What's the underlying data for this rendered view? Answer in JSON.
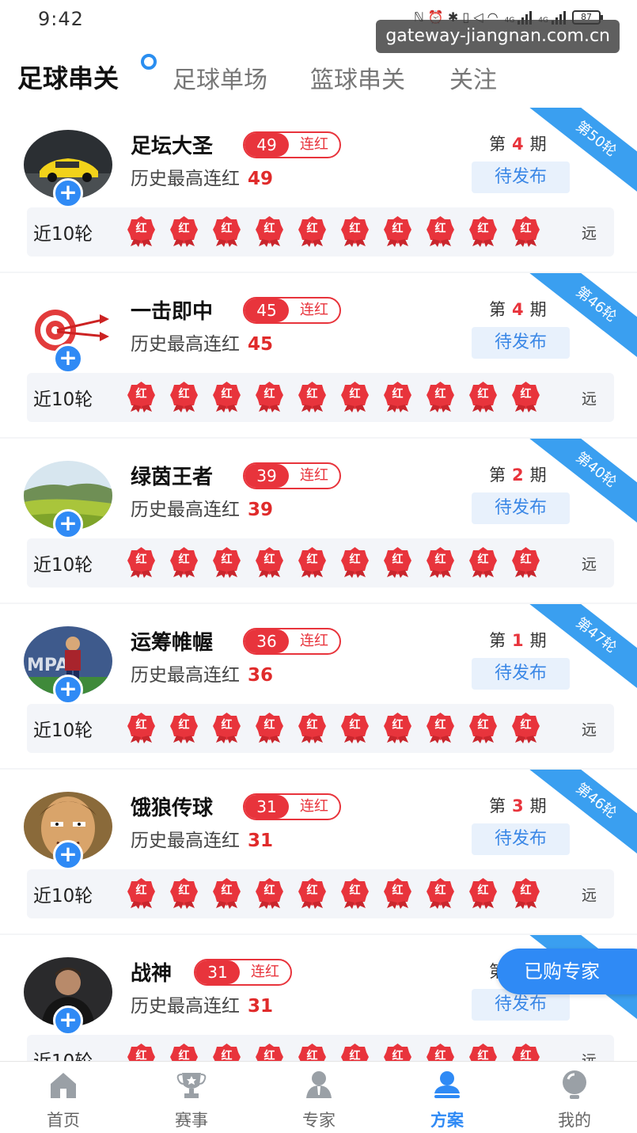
{
  "status_bar": {
    "time": "9:42",
    "icons": "ℕ ⏰ ✱ ▯ ◁ ◠",
    "sig1": "4G",
    "sig2": "4G",
    "battery": "87"
  },
  "watermark": "gateway-jiangnan.com.cn",
  "tabs": [
    {
      "label": "足球串关",
      "active": true
    },
    {
      "label": "足球单场",
      "active": false
    },
    {
      "label": "篮球串关",
      "active": false
    },
    {
      "label": "关注",
      "active": false
    }
  ],
  "labels": {
    "streak_suffix": "连红",
    "history_prefix": "历史最高连红",
    "period_prefix": "第",
    "period_suffix": "期",
    "recent": "近10轮",
    "badge": "红",
    "far": "远",
    "status": "待发布"
  },
  "experts": [
    {
      "name": "足坛大圣",
      "streak": "49",
      "history": "49",
      "period": "4",
      "round": "第50轮"
    },
    {
      "name": "一击即中",
      "streak": "45",
      "history": "45",
      "period": "4",
      "round": "第46轮"
    },
    {
      "name": "绿茵王者",
      "streak": "39",
      "history": "39",
      "period": "2",
      "round": "第40轮"
    },
    {
      "name": "运筹帷幄",
      "streak": "36",
      "history": "36",
      "period": "1",
      "round": "第47轮"
    },
    {
      "name": "饿狼传球",
      "streak": "31",
      "history": "31",
      "period": "3",
      "round": "第46轮"
    },
    {
      "name": "战神",
      "streak": "31",
      "history": "31",
      "period": "",
      "round": ""
    }
  ],
  "float_button": "已购专家",
  "nav": [
    {
      "label": "首页",
      "icon": "home-icon",
      "active": false
    },
    {
      "label": "赛事",
      "icon": "trophy-icon",
      "active": false
    },
    {
      "label": "专家",
      "icon": "expert-icon",
      "active": false
    },
    {
      "label": "方案",
      "icon": "plan-icon",
      "active": true
    },
    {
      "label": "我的",
      "icon": "profile-icon",
      "active": false
    }
  ],
  "colors": {
    "accent_blue": "#2f8af5",
    "accent_red": "#e8343c"
  }
}
